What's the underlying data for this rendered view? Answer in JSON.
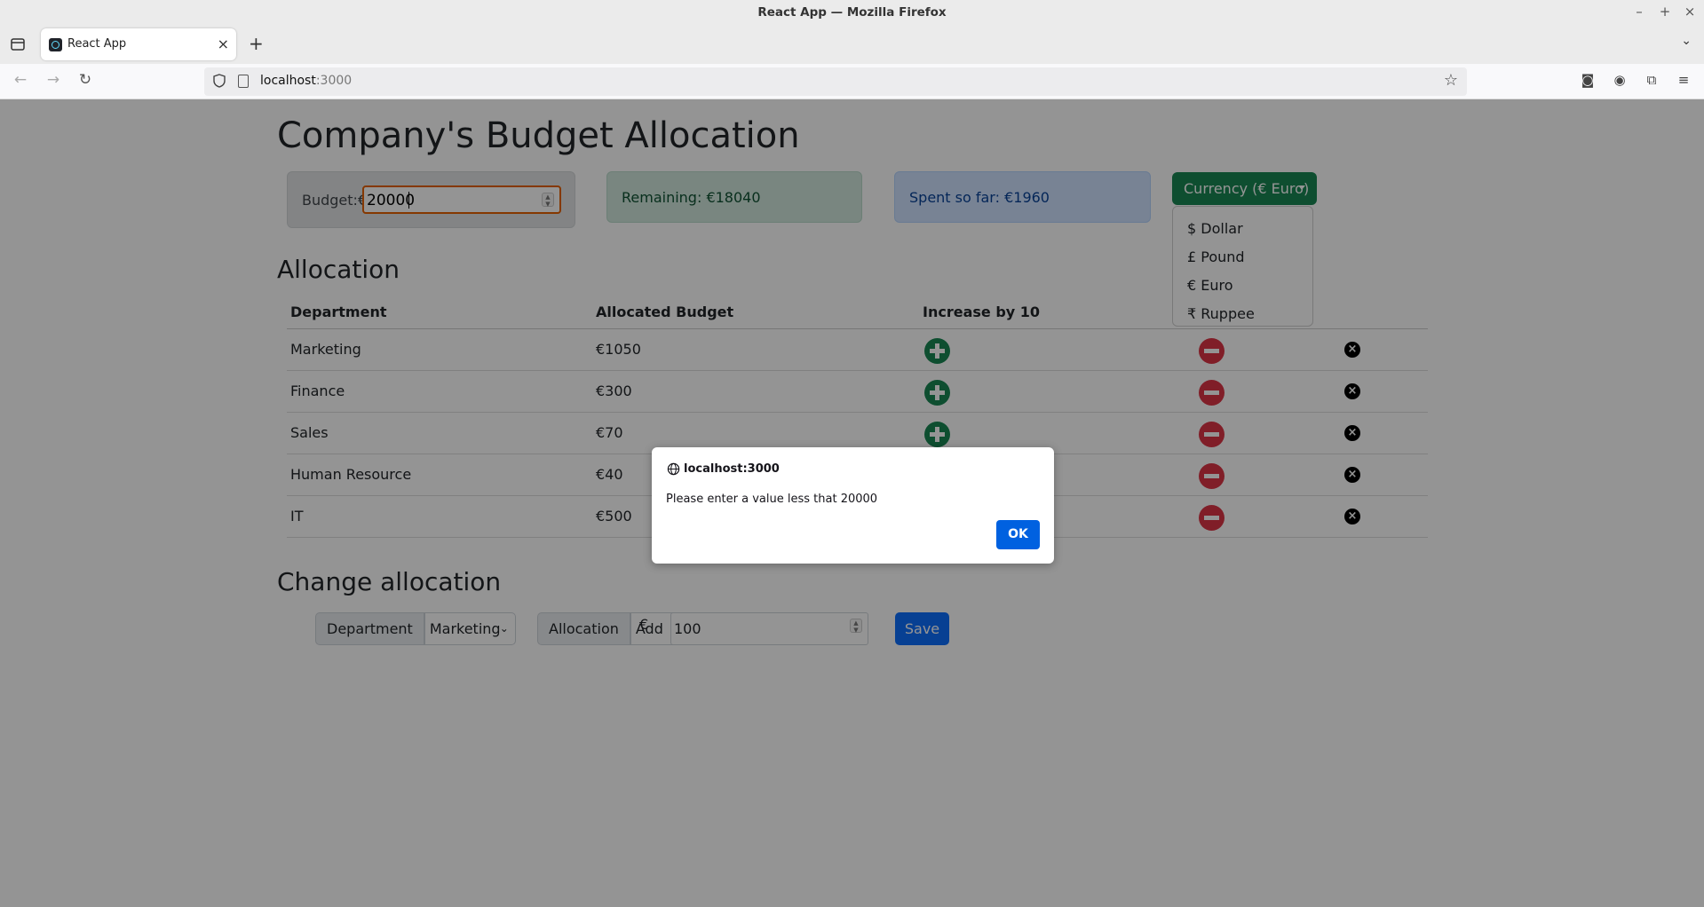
{
  "window": {
    "title": "React App — Mozilla Firefox",
    "min_icon": "–",
    "max_icon": "+",
    "close_icon": "×"
  },
  "tabs": [
    {
      "label": "React App"
    }
  ],
  "tab_close": "×",
  "new_tab": "+",
  "address": {
    "host": "localhost",
    "port": ":3000"
  },
  "app": {
    "title": "Company's Budget Allocation",
    "budget": {
      "label": "Budget:€",
      "value": "20000"
    },
    "remaining": "Remaining: €18040",
    "spent": "Spent so far: €1960",
    "currency": {
      "button_label": "Currency (€ Euro)",
      "options": [
        "$ Dollar",
        "£ Pound",
        "€ Euro",
        "₹ Ruppee"
      ]
    },
    "allocation_heading": "Allocation",
    "table": {
      "headers": [
        "Department",
        "Allocated Budget",
        "Increase by 10"
      ],
      "rows": [
        {
          "department": "Marketing",
          "budget": "€1050"
        },
        {
          "department": "Finance",
          "budget": "€300"
        },
        {
          "department": "Sales",
          "budget": "€70"
        },
        {
          "department": "Human Resource",
          "budget": "€40"
        },
        {
          "department": "IT",
          "budget": "€500"
        }
      ]
    },
    "change_heading": "Change allocation",
    "change_form": {
      "department_label": "Department",
      "department_value": "Marketing",
      "allocation_label": "Allocation",
      "allocation_value": "Add",
      "currency_symbol": "€",
      "amount_value": "100",
      "save_label": "Save"
    }
  },
  "alert": {
    "host": "localhost:3000",
    "message": "Please enter a value less that 20000",
    "ok_label": "OK"
  },
  "colors": {
    "success": "#198754",
    "danger": "#dc3545",
    "primary": "#0d6efd",
    "dialog_ok": "#0061e0"
  }
}
